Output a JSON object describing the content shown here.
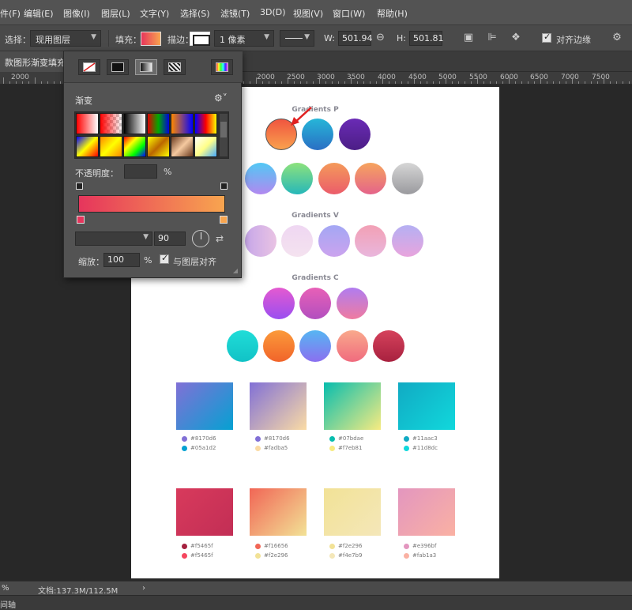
{
  "menu": {
    "items": [
      "件(F)",
      "编辑(E)",
      "图像(I)",
      "图层(L)",
      "文字(Y)",
      "选择(S)",
      "滤镜(T)",
      "3D(D)",
      "视图(V)",
      "窗口(W)",
      "帮助(H)"
    ]
  },
  "options_bar": {
    "select_label": "选择：",
    "select_value": "现用图层",
    "fill_label": "填充：",
    "stroke_label": "描边：",
    "stroke_width": "1 像素",
    "w_label": "W:",
    "w_value": "501.94",
    "h_label": "H:",
    "h_value": "501.81",
    "align_edges_label": "对齐边缘"
  },
  "document_tab": {
    "title": "款图形渐变填充"
  },
  "ruler": {
    "labels": [
      "2000",
      "2000",
      "2500",
      "3000",
      "3500",
      "4000",
      "4500",
      "5000",
      "5500",
      "6000",
      "6500",
      "7000",
      "7500"
    ]
  },
  "canvas": {
    "sections": [
      "Gradients P",
      "Gradients V",
      "Gradients C"
    ],
    "swatch_hex": [
      [
        "#8170d6",
        "#05a1d2"
      ],
      [
        "#8170d6",
        "#fadba5"
      ],
      [
        "#07bdae",
        "#f7eb81"
      ],
      [
        "#11aac3",
        "#11d8dc"
      ],
      [
        "#f5465f",
        "#f5465f"
      ],
      [
        "#f16656",
        "#f2e296"
      ],
      [
        "#f2e296",
        "#f4e7b9"
      ],
      [
        "#e396bf",
        "#fab1a3"
      ]
    ]
  },
  "gradient_panel": {
    "title": "渐变",
    "opacity_label": "不透明度：",
    "opacity_unit": "%",
    "angle_value": "90",
    "scale_label": "缩放：",
    "scale_value": "100",
    "scale_unit": "%",
    "align_layer_label": "与图层对齐"
  },
  "status_bar": {
    "zoom": "%",
    "doc_info": "文档:137.3M/112.5M",
    "timeline_label": "间轴"
  },
  "colors": {
    "fill_start": "#e6355c",
    "fill_end": "#f8a54f"
  },
  "icons": [
    "link-icon",
    "path-operations-icon",
    "path-alignment-icon",
    "path-arrangement-icon",
    "gear-icon",
    "angle-dial-icon",
    "reverse-icon",
    "annotation-arrow-icon"
  ]
}
